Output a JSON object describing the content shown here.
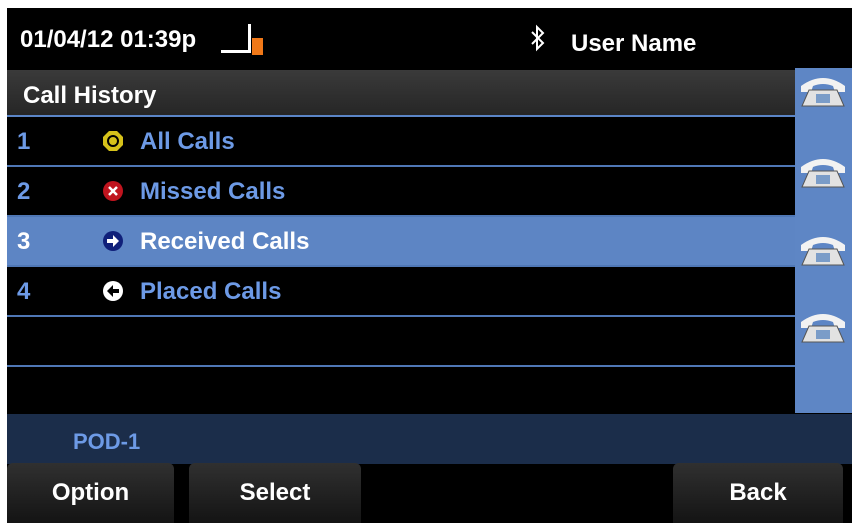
{
  "status_bar": {
    "datetime": "01/04/12 01:39p",
    "username": "User Name"
  },
  "title": "Call History",
  "items": [
    {
      "number": "1",
      "label": "All Calls",
      "icon": "all-calls-icon",
      "selected": false
    },
    {
      "number": "2",
      "label": "Missed Calls",
      "icon": "missed-calls-icon",
      "selected": false
    },
    {
      "number": "3",
      "label": "Received Calls",
      "icon": "received-calls-icon",
      "selected": true
    },
    {
      "number": "4",
      "label": "Placed Calls",
      "icon": "placed-calls-icon",
      "selected": false
    }
  ],
  "pod": "POD-1",
  "softkeys": {
    "option": "Option",
    "select": "Select",
    "back": "Back"
  },
  "colors": {
    "accent": "#5d85c4",
    "list_text": "#6d9ae6",
    "missed": "#c0141e",
    "all_calls": "#d6c21a"
  }
}
